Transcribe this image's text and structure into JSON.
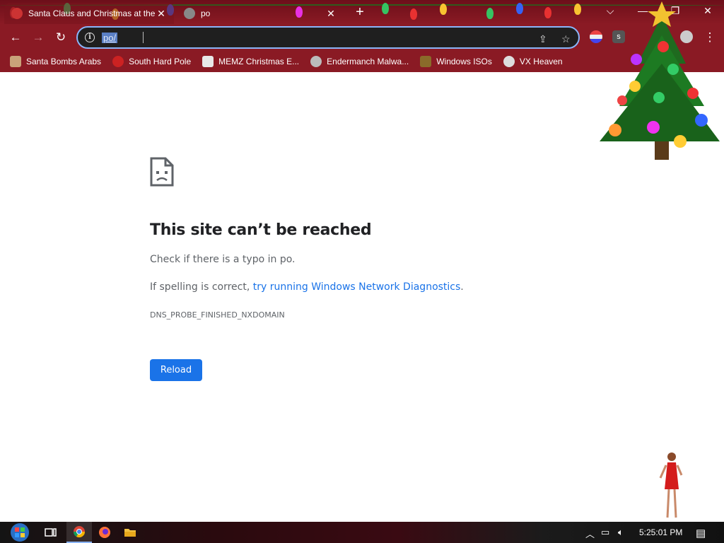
{
  "tabs": [
    {
      "title": "Santa Claus and Christmas at the",
      "active": true
    },
    {
      "title": "po",
      "active": false
    }
  ],
  "window_controls": {
    "minimize": "—",
    "maximize": "❐",
    "close": "✕",
    "tab_search": "⌵"
  },
  "toolbar": {
    "back": "←",
    "forward": "→",
    "reload": "↻",
    "url": "po/",
    "share_icon": "share-icon",
    "star_icon": "bookmark-star-icon"
  },
  "bookmarks": [
    {
      "label": "Santa Bombs Arabs",
      "color": "#c9a27a"
    },
    {
      "label": "South Hard Pole",
      "color": "#cc2222"
    },
    {
      "label": "MEMZ Christmas E...",
      "color": "#e8e8e8"
    },
    {
      "label": "Endermanch Malwa...",
      "color": "#bbbbbb"
    },
    {
      "label": "Windows ISOs",
      "color": "#8a6b2a"
    },
    {
      "label": "VX Heaven",
      "color": "#dddddd"
    }
  ],
  "error": {
    "title": "This site can’t be reached",
    "check_text": "Check if there is a typo in po.",
    "spelling_prefix": "If spelling is correct, ",
    "diagnostics_link": "try running Windows Network Diagnostics",
    "spelling_suffix": ".",
    "code": "DNS_PROBE_FINISHED_NXDOMAIN",
    "reload_label": "Reload"
  },
  "taskbar": {
    "clock": "5:25:01 PM",
    "apps": [
      "start-icon",
      "task-view-icon",
      "chrome-icon",
      "firefox-icon",
      "file-explorer-icon"
    ]
  },
  "colors": {
    "chrome_frame": "#8a1a24",
    "link": "#1a73e8",
    "button": "#1a73e8",
    "omnibox_border": "#8ab4f8"
  }
}
